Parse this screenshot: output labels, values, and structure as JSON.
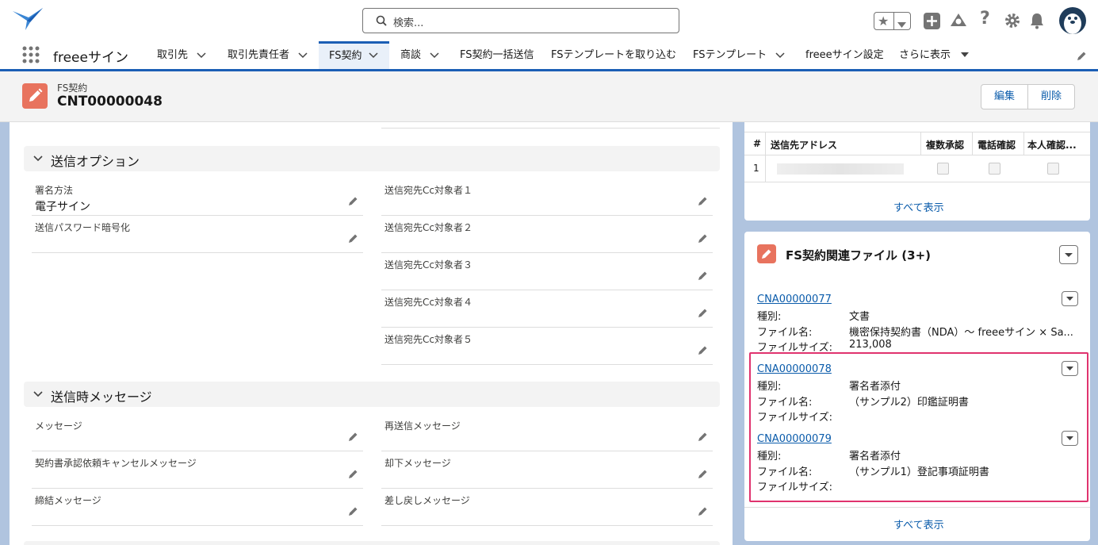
{
  "search": {
    "placeholder": "検索..."
  },
  "app": {
    "name": "freeeサイン"
  },
  "nav": {
    "items": [
      {
        "label": "取引先",
        "chevron": true
      },
      {
        "label": "取引先責任者",
        "chevron": true
      },
      {
        "label": "FS契約",
        "chevron": true,
        "active": true
      },
      {
        "label": "商談",
        "chevron": true
      },
      {
        "label": "FS契約一括送信",
        "chevron": false
      },
      {
        "label": "FSテンプレートを取り込む",
        "chevron": false
      },
      {
        "label": "FSテンプレート",
        "chevron": true
      },
      {
        "label": "freeeサイン設定",
        "chevron": false
      },
      {
        "label": "さらに表示",
        "chevron": true
      }
    ]
  },
  "record": {
    "object": "FS契約",
    "name": "CNT00000048",
    "edit_label": "編集",
    "delete_label": "削除"
  },
  "left": {
    "send_options": {
      "title": "送信オプション",
      "signing_method_label": "署名方法",
      "signing_method_value": "電子サイン",
      "password_label": "送信パスワード暗号化",
      "cc": [
        "送信宛先Cc対象者１",
        "送信宛先Cc対象者２",
        "送信宛先Cc対象者３",
        "送信宛先Cc対象者４",
        "送信宛先Cc対象者５"
      ]
    },
    "messages": {
      "title": "送信時メッセージ",
      "fields": [
        "メッセージ",
        "再送信メッセージ",
        "契約書承認依頼キャンセルメッセージ",
        "却下メッセージ",
        "締結メッセージ",
        "差し戻しメッセージ"
      ]
    }
  },
  "recipients": {
    "columns": [
      "#",
      "送信先アドレス",
      "複数承認",
      "電話確認",
      "本人確認..."
    ],
    "rows": [
      {
        "num": "1"
      }
    ],
    "show_all": "すべて表示"
  },
  "files": {
    "title": "FS契約関連ファイル (3+)",
    "type_label": "種別:",
    "name_label": "ファイル名:",
    "size_label": "ファイルサイズ:",
    "items": [
      {
        "id": "CNA00000077",
        "type": "文書",
        "filename": "機密保持契約書（NDA）〜 freeeサイン × Sa...",
        "size": "213,008"
      },
      {
        "id": "CNA00000078",
        "type": "署名者添付",
        "filename": "（サンプル2）印鑑証明書",
        "size": ""
      },
      {
        "id": "CNA00000079",
        "type": "署名者添付",
        "filename": "（サンプル1）登記事項証明書",
        "size": ""
      }
    ],
    "show_all": "すべて表示"
  },
  "colors": {
    "accent": "#1b5eb5",
    "link": "#0b5cab",
    "record_icon": "#e8735e",
    "highlight": "#e0336e"
  }
}
